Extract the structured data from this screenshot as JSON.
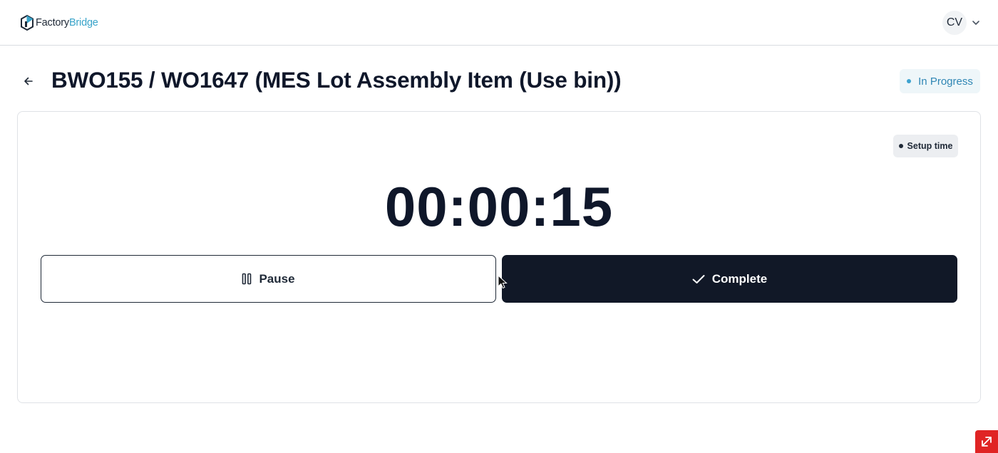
{
  "header": {
    "logo": {
      "part1": "Factory",
      "part2": "Bridge",
      "icon": "factorybridge-logo-icon"
    },
    "user": {
      "initials": "CV",
      "icon": "chevron-down-icon"
    }
  },
  "page": {
    "title": "BWO155 / WO1647 (MES Lot Assembly Item (Use bin))",
    "status": "In Progress",
    "back_icon": "arrow-left-icon"
  },
  "timer_card": {
    "phase": "Setup time",
    "elapsed": "00:00:15",
    "pause_label": "Pause",
    "complete_label": "Complete",
    "pause_icon": "pause-icon",
    "complete_icon": "check-icon"
  },
  "colors": {
    "brand": "#38a3c9",
    "status_text": "#2f86b4",
    "status_bg": "#eef6f9",
    "primary_button": "#111827",
    "corner_widget": "#e02424"
  }
}
